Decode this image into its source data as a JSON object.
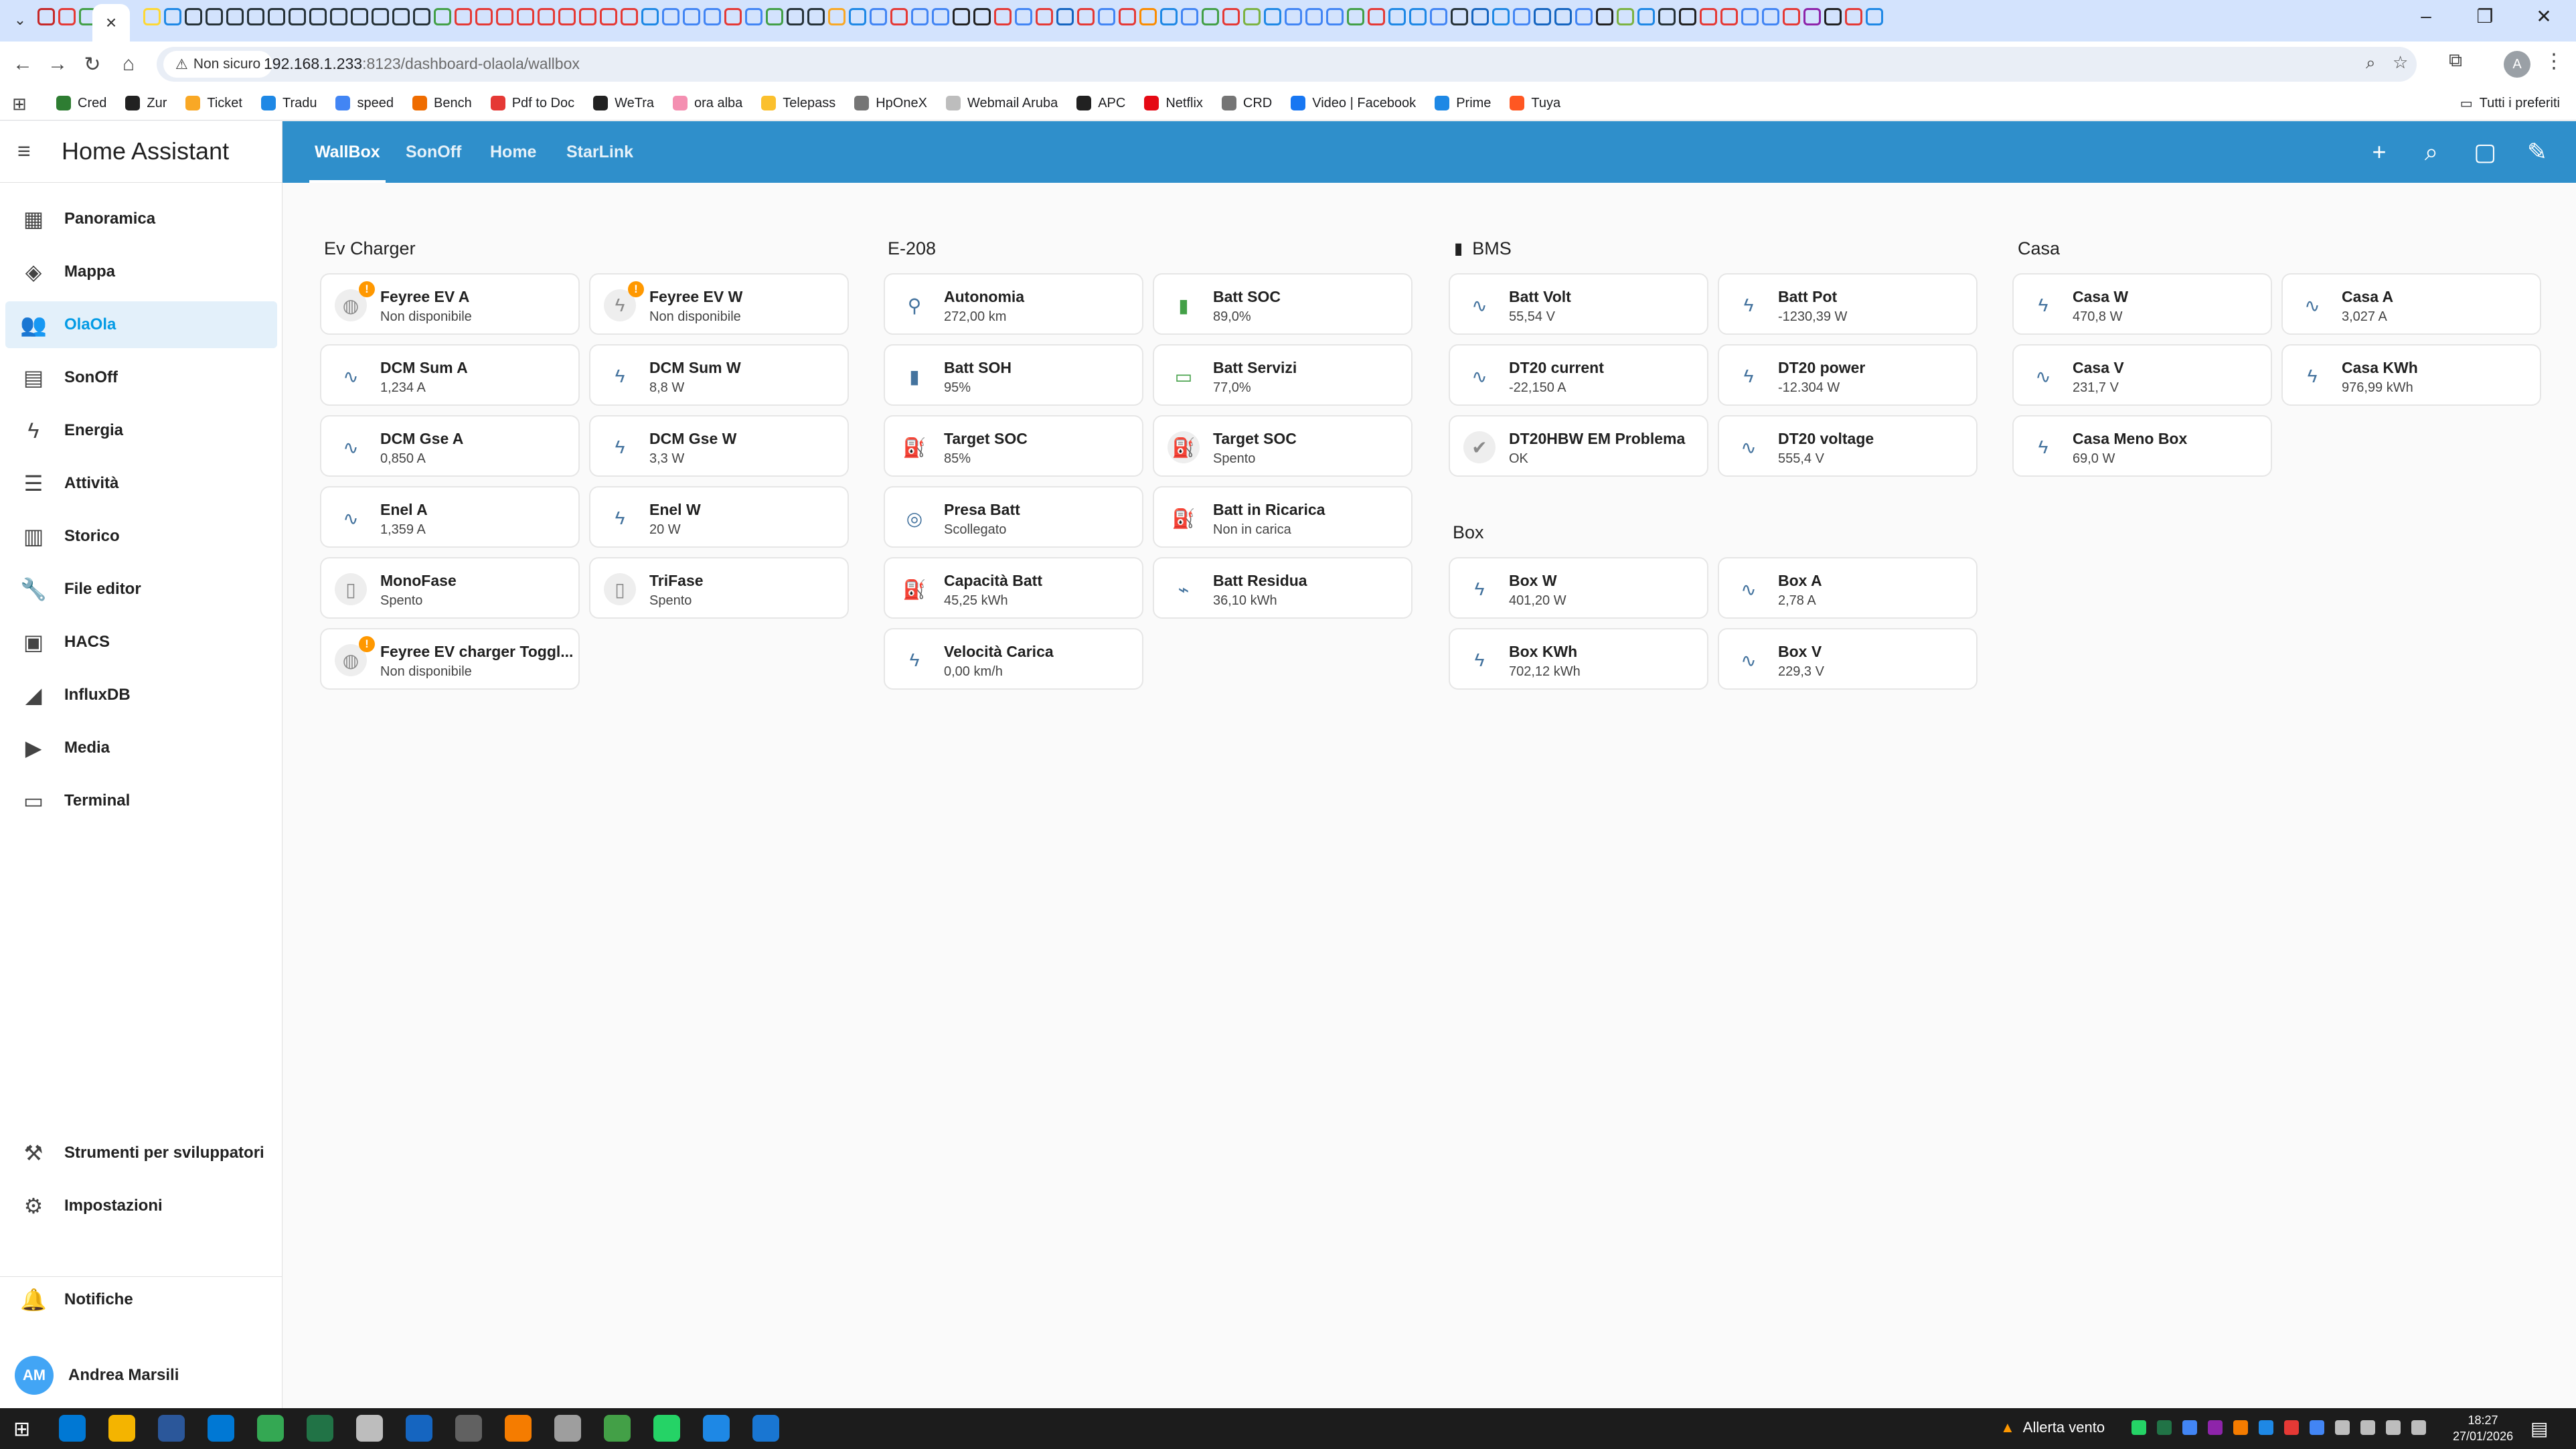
{
  "browser": {
    "tab_overflow_icon": "chevron-down-icon",
    "active_tab_close": "×",
    "tab_favicon_colors": [
      "#c62828",
      "#e53935",
      "#43a047",
      "#fdd835",
      "#1e88e5",
      "#263238",
      "#263238",
      "#263238",
      "#263238",
      "#263238",
      "#263238",
      "#263238",
      "#263238",
      "#263238",
      "#263238",
      "#263238",
      "#263238",
      "#43a047",
      "#e53935",
      "#e53935",
      "#e53935",
      "#e53935",
      "#e53935",
      "#e53935",
      "#e53935",
      "#e53935",
      "#e53935",
      "#1e88e5",
      "#4285f4",
      "#4285f4",
      "#4285f4",
      "#e53935",
      "#4285f4",
      "#43a047",
      "#263238",
      "#263238",
      "#f9a825",
      "#1e88e5",
      "#4285f4",
      "#e53935",
      "#4285f4",
      "#4285f4",
      "#212121",
      "#212121",
      "#e53935",
      "#4285f4",
      "#e53935",
      "#1565c0",
      "#e53935",
      "#4285f4",
      "#e53935",
      "#fb8c00",
      "#1e88e5",
      "#4285f4",
      "#43a047",
      "#e53935",
      "#7cb342",
      "#1e88e5",
      "#4285f4",
      "#4285f4",
      "#4285f4",
      "#43a047",
      "#e53935",
      "#1e88e5",
      "#1e88e5",
      "#4285f4",
      "#263238",
      "#1565c0",
      "#1e88e5",
      "#4285f4",
      "#1565c0",
      "#1565c0",
      "#4285f4",
      "#212121",
      "#7cb342",
      "#1e88e5",
      "#263238",
      "#212121",
      "#e53935",
      "#e53935",
      "#4285f4",
      "#4285f4",
      "#e53935",
      "#8e24aa",
      "#212121",
      "#e53935",
      "#1e88e5"
    ],
    "window_controls": [
      "–",
      "❐",
      "✕"
    ],
    "back_icon": "←",
    "forward_icon": "→",
    "reload_icon": "↻",
    "home_icon": "⌂",
    "insecure_label": "Non sicuro",
    "url_host": "192.168.1.233",
    "url_rest": ":8123/dashboard-olaola/wallbox",
    "profile_initial": "A",
    "bookmarks": [
      {
        "label": "Cred",
        "color": "#2e7d32"
      },
      {
        "label": "Zur",
        "color": "#212121"
      },
      {
        "label": "Ticket",
        "color": "#f9a825"
      },
      {
        "label": "Tradu",
        "color": "#1e88e5"
      },
      {
        "label": "speed",
        "color": "#4285f4"
      },
      {
        "label": "Bench",
        "color": "#ef6c00"
      },
      {
        "label": "Pdf to Doc",
        "color": "#e53935"
      },
      {
        "label": "WeTra",
        "color": "#212121"
      },
      {
        "label": "ora alba",
        "color": "#f48fb1"
      },
      {
        "label": "Telepass",
        "color": "#fbc02d"
      },
      {
        "label": "HpOneX",
        "color": "#757575"
      },
      {
        "label": "Webmail Aruba",
        "color": "#bdbdbd"
      },
      {
        "label": "APC",
        "color": "#212121"
      },
      {
        "label": "Netflix",
        "color": "#e50914"
      },
      {
        "label": "CRD",
        "color": "#757575"
      },
      {
        "label": "Video | Facebook",
        "color": "#1877f2"
      },
      {
        "label": "Prime",
        "color": "#1e88e5"
      },
      {
        "label": "Tuya",
        "color": "#ff5722"
      }
    ],
    "all_bookmarks": "Tutti i preferiti"
  },
  "ha": {
    "title": "Home Assistant",
    "sidebar": [
      {
        "label": "Panoramica",
        "icon": "▦",
        "name": "overview-icon"
      },
      {
        "label": "Mappa",
        "icon": "◈",
        "name": "map-icon"
      },
      {
        "label": "OlaOla",
        "icon": "👥",
        "name": "people-icon",
        "active": true
      },
      {
        "label": "SonOff",
        "icon": "▤",
        "name": "grid-icon"
      },
      {
        "label": "Energia",
        "icon": "ϟ",
        "name": "lightning-icon"
      },
      {
        "label": "Attività",
        "icon": "☰",
        "name": "list-icon"
      },
      {
        "label": "Storico",
        "icon": "▥",
        "name": "chart-icon"
      },
      {
        "label": "File editor",
        "icon": "🔧",
        "name": "wrench-icon"
      },
      {
        "label": "HACS",
        "icon": "▣",
        "name": "hacs-icon"
      },
      {
        "label": "InfluxDB",
        "icon": "◢",
        "name": "influx-icon"
      },
      {
        "label": "Media",
        "icon": "▶",
        "name": "media-icon"
      },
      {
        "label": "Terminal",
        "icon": "▭",
        "name": "terminal-icon"
      }
    ],
    "sidebar_bottom": [
      {
        "label": "Strumenti per sviluppatori",
        "icon": "⚒",
        "name": "hammer-icon"
      },
      {
        "label": "Impostazioni",
        "icon": "⚙",
        "name": "gear-icon"
      },
      {
        "label": "Notifiche",
        "icon": "🔔",
        "name": "bell-icon"
      }
    ],
    "user": {
      "initials": "AM",
      "name": "Andrea Marsili"
    },
    "views": [
      "WallBox",
      "SonOff",
      "Home",
      "StarLink"
    ],
    "actions": [
      {
        "icon": "+",
        "name": "add-icon"
      },
      {
        "icon": "⌕",
        "name": "search-icon"
      },
      {
        "icon": "▢",
        "name": "assist-icon"
      },
      {
        "icon": "✎",
        "name": "edit-icon"
      }
    ],
    "sections": [
      {
        "title": "Ev Charger",
        "icon": "",
        "cards": [
          {
            "name": "Feyree EV A",
            "state": "Non disponibile",
            "icon": "◍",
            "style": "grey",
            "badge": "!"
          },
          {
            "name": "Feyree EV W",
            "state": "Non disponibile",
            "icon": "ϟ",
            "style": "grey",
            "badge": "!"
          },
          {
            "name": "DCM Sum A",
            "state": "1,234 A",
            "icon": "∿"
          },
          {
            "name": "DCM Sum W",
            "state": "8,8 W",
            "icon": "ϟ"
          },
          {
            "name": "DCM Gse A",
            "state": "0,850 A",
            "icon": "∿"
          },
          {
            "name": "DCM Gse W",
            "state": "3,3 W",
            "icon": "ϟ"
          },
          {
            "name": "Enel A",
            "state": "1,359 A",
            "icon": "∿"
          },
          {
            "name": "Enel W",
            "state": "20 W",
            "icon": "ϟ"
          },
          {
            "name": "MonoFase",
            "state": "Spento",
            "icon": "▯",
            "style": "grey"
          },
          {
            "name": "TriFase",
            "state": "Spento",
            "icon": "▯",
            "style": "grey"
          },
          {
            "name": "Feyree EV charger Toggl...",
            "state": "Non disponibile",
            "icon": "◍",
            "style": "grey",
            "badge": "!"
          }
        ]
      },
      {
        "title": "E-208",
        "icon": "",
        "cards": [
          {
            "name": "Autonomia",
            "state": "272,00 km",
            "icon": "⚲"
          },
          {
            "name": "Batt SOC",
            "state": "89,0%",
            "icon": "▮",
            "style": "green"
          },
          {
            "name": "Batt SOH",
            "state": "95%",
            "icon": "▮"
          },
          {
            "name": "Batt Servizi",
            "state": "77,0%",
            "icon": "▭",
            "style": "green"
          },
          {
            "name": "Target SOC",
            "state": "85%",
            "icon": "⛽"
          },
          {
            "name": "Target SOC",
            "state": "Spento",
            "icon": "⛽",
            "style": "grey"
          },
          {
            "name": "Presa Batt",
            "state": "Scollegato",
            "icon": "◎"
          },
          {
            "name": "Batt in Ricarica",
            "state": "Non in carica",
            "icon": "⛽"
          },
          {
            "name": "Capacità Batt",
            "state": "45,25 kWh",
            "icon": "⛽"
          },
          {
            "name": "Batt Residua",
            "state": "36,10 kWh",
            "icon": "⌁"
          },
          {
            "name": "Velocità Carica",
            "state": "0,00 km/h",
            "icon": "ϟ"
          }
        ]
      },
      {
        "title": "BMS",
        "icon": "▮",
        "cards": [
          {
            "name": "Batt Volt",
            "state": "55,54 V",
            "icon": "∿"
          },
          {
            "name": "Batt Pot",
            "state": "-1230,39 W",
            "icon": "ϟ"
          },
          {
            "name": "DT20 current",
            "state": "-22,150 A",
            "icon": "∿"
          },
          {
            "name": "DT20 power",
            "state": "-12.304 W",
            "icon": "ϟ"
          },
          {
            "name": "DT20HBW EM Problema",
            "state": "OK",
            "icon": "✔",
            "style": "grey"
          },
          {
            "name": "DT20 voltage",
            "state": "555,4 V",
            "icon": "∿"
          }
        ]
      },
      {
        "title": "Box",
        "icon": "",
        "cards": [
          {
            "name": "Box W",
            "state": "401,20 W",
            "icon": "ϟ"
          },
          {
            "name": "Box A",
            "state": "2,78 A",
            "icon": "∿"
          },
          {
            "name": "Box KWh",
            "state": "702,12 kWh",
            "icon": "ϟ"
          },
          {
            "name": "Box V",
            "state": "229,3 V",
            "icon": "∿"
          }
        ]
      },
      {
        "title": "Casa",
        "icon": "",
        "cards": [
          {
            "name": "Casa W",
            "state": "470,8 W",
            "icon": "ϟ"
          },
          {
            "name": "Casa A",
            "state": "3,027 A",
            "icon": "∿"
          },
          {
            "name": "Casa V",
            "state": "231,7 V",
            "icon": "∿"
          },
          {
            "name": "Casa KWh",
            "state": "976,99 kWh",
            "icon": "ϟ"
          },
          {
            "name": "Casa Meno Box",
            "state": "69,0 W",
            "icon": "ϟ"
          }
        ]
      }
    ]
  },
  "taskbar": {
    "app_colors": [
      "#0078d4",
      "#f4b400",
      "#2b579a",
      "#0078d4",
      "#34a853",
      "#217346",
      "#bdbdbd",
      "#1565c0",
      "#616161",
      "#f57c00",
      "#9e9e9e",
      "#43a047",
      "#25d366",
      "#1e88e5",
      "#1976d2"
    ],
    "weather": "Allerta vento",
    "time": "18:27",
    "date": "27/01/2026",
    "tray_colors": [
      "#25d366",
      "#217346",
      "#4285f4",
      "#8e24aa",
      "#f57c00",
      "#1e88e5",
      "#e53935",
      "#4285f4",
      "#bdbdbd",
      "#bdbdbd",
      "#bdbdbd",
      "#bdbdbd"
    ]
  }
}
